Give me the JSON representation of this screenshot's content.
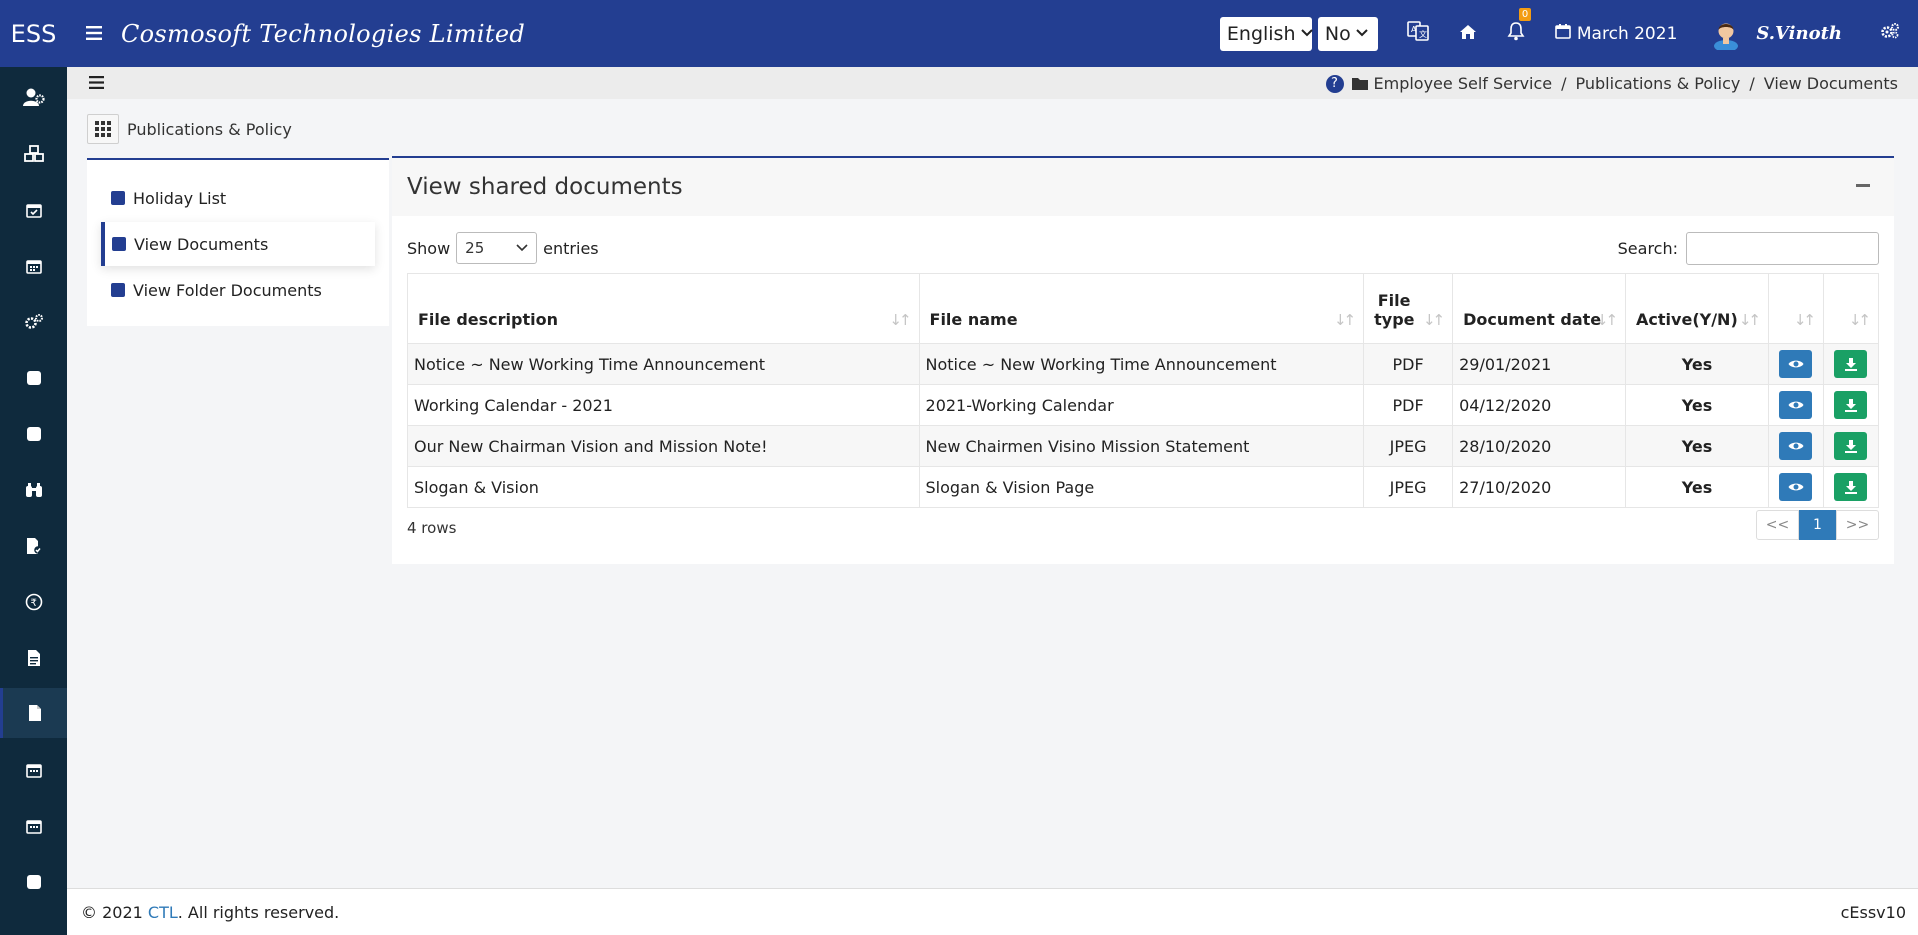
{
  "header": {
    "brand": "ESS",
    "company": "Cosmosoft Technologies Limited",
    "language": "English",
    "option": "No",
    "notifications_count": "0",
    "period": "March 2021",
    "user": "S.Vinoth"
  },
  "breadcrumb": [
    "Employee Self Service",
    "Publications & Policy",
    "View Documents"
  ],
  "module": {
    "title": "Publications & Policy"
  },
  "left_menu": [
    {
      "label": "Holiday List"
    },
    {
      "label": "View Documents",
      "active": true
    },
    {
      "label": "View Folder Documents"
    }
  ],
  "panel": {
    "title": "View shared documents",
    "show_label": "Show",
    "page_size": "25",
    "entries_label": "entries",
    "search_label": "Search:",
    "search_value": ""
  },
  "table": {
    "columns": [
      "File description",
      "File name",
      "File type",
      "Document date",
      "Active(Y/N)"
    ],
    "rows": [
      {
        "description": "Notice ~ New Working Time Announcement",
        "filename": "Notice ~ New Working Time Announcement",
        "type": "PDF",
        "date": "29/01/2021",
        "active": "Yes"
      },
      {
        "description": "Working Calendar - 2021",
        "filename": "2021-Working Calendar",
        "type": "PDF",
        "date": "04/12/2020",
        "active": "Yes"
      },
      {
        "description": "Our New Chairman Vision and Mission Note!",
        "filename": "New Chairmen Visino Mission Statement",
        "type": "JPEG",
        "date": "28/10/2020",
        "active": "Yes"
      },
      {
        "description": "Slogan & Vision",
        "filename": "Slogan & Vision Page",
        "type": "JPEG",
        "date": "27/10/2020",
        "active": "Yes"
      }
    ],
    "row_count": "4 rows"
  },
  "pagination": {
    "prev": "<<",
    "current": "1",
    "next": ">>"
  },
  "footer": {
    "copyright_prefix": "© 2021 ",
    "company_link": "CTL",
    "copyright_suffix": ". All rights reserved.",
    "version": "cEssv10"
  },
  "colors": {
    "primary": "#233e91",
    "rail": "#0f2a3d",
    "view_btn": "#2f7ab8",
    "download_btn": "#1aa065",
    "yes": "#2a8a1e"
  }
}
